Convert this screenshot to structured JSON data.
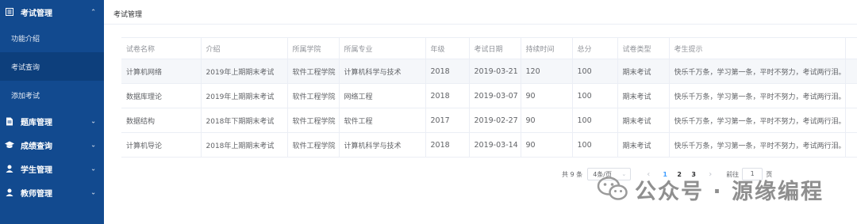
{
  "sidebar": {
    "menus": [
      {
        "label": "考试管理",
        "icon": "list-icon",
        "chevron": "⌃"
      },
      {
        "label": "题库管理",
        "icon": "document-icon",
        "chevron": "⌄"
      },
      {
        "label": "成绩查询",
        "icon": "graduation-cap-icon",
        "chevron": "⌄"
      },
      {
        "label": "学生管理",
        "icon": "user-icon",
        "chevron": "⌄"
      },
      {
        "label": "教师管理",
        "icon": "user-icon",
        "chevron": "⌄"
      }
    ],
    "sub_items": [
      "功能介绍",
      "考试查询",
      "添加考试"
    ]
  },
  "header": {
    "breadcrumb": "考试管理"
  },
  "table": {
    "columns": [
      "试卷名称",
      "介绍",
      "所属学院",
      "所属专业",
      "年级",
      "考试日期",
      "持续时间",
      "总分",
      "试卷类型",
      "考生提示"
    ],
    "rows": [
      [
        "计算机网络",
        "2019年上期期末考试",
        "软件工程学院",
        "计算机科学与技术",
        "2018",
        "2019-03-21",
        "120",
        "100",
        "期末考试",
        "快乐千万条，学习第一条，平时不努力，考试两行泪。"
      ],
      [
        "数据库理论",
        "2019年上期期末考试",
        "软件工程学院",
        "网络工程",
        "2018",
        "2019-03-07",
        "90",
        "100",
        "期末考试",
        "快乐千万条，学习第一条，平时不努力，考试两行泪。"
      ],
      [
        "数据结构",
        "2018年下期期末考试",
        "软件工程学院",
        "软件工程",
        "2017",
        "2019-02-27",
        "90",
        "100",
        "期末考试",
        "快乐千万条，学习第一条，平时不努力，考试两行泪。"
      ],
      [
        "计算机导论",
        "2018年上期期末考试",
        "软件工程学院",
        "计算机科学与技术",
        "2018",
        "2019-03-14",
        "90",
        "100",
        "期末考试",
        "快乐千万条，学习第一条，平时不努力，考试两行泪。"
      ]
    ]
  },
  "pagination": {
    "total": "共 9 条",
    "page_size": "4条/页",
    "prev": "‹",
    "pages": [
      "1",
      "2",
      "3"
    ],
    "current": "1",
    "next": "›",
    "goto_label": "前往",
    "goto_value": "1",
    "goto_suffix": "页"
  },
  "watermark": {
    "text": "公众号 · 源缘编程"
  },
  "colors": {
    "sidebar_bg": "#124a8f",
    "accent": "#409eff"
  }
}
